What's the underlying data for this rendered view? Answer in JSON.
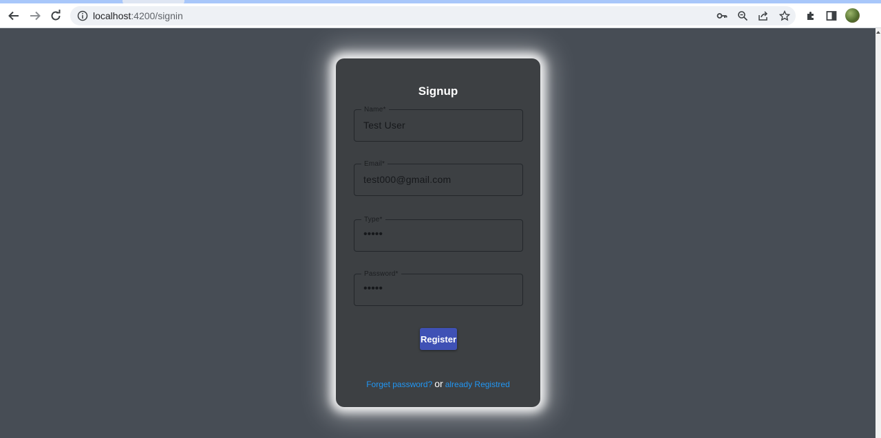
{
  "browser": {
    "url_host": "localhost",
    "url_rest": ":4200/signin",
    "icons": [
      "back-icon",
      "forward-icon",
      "reload-icon",
      "info-icon",
      "key-icon",
      "zoom-icon",
      "share-icon",
      "star-icon",
      "extensions-icon",
      "sidepanel-icon",
      "avatar"
    ]
  },
  "form": {
    "title": "Signup",
    "fields": [
      {
        "label": "Name*",
        "value": "Test User"
      },
      {
        "label": "Email*",
        "value": "test000@gmail.com"
      },
      {
        "label": "Type*",
        "value": "•••••"
      },
      {
        "label": "Password*",
        "value": "•••••"
      }
    ],
    "register_label": "Register",
    "forgot_link": "Forget password?",
    "or_text": "or",
    "registered_link": "already Registred"
  },
  "colors": {
    "page_bg": "#474d55",
    "card_bg": "#3d4043",
    "button": "#3f51b5",
    "link": "#2196f3"
  }
}
